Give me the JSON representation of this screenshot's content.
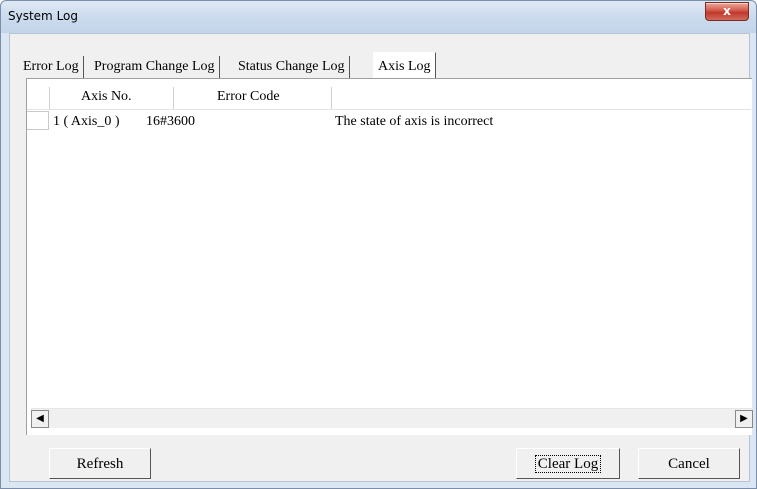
{
  "window": {
    "title": "System Log",
    "close_glyph": "x"
  },
  "tabs": [
    {
      "label": "Error Log"
    },
    {
      "label": "Program Change Log"
    },
    {
      "label": "Status Change Log"
    },
    {
      "label": "Axis Log",
      "active": true
    }
  ],
  "table": {
    "columns": [
      "Axis No.",
      "Error Code",
      ""
    ],
    "rows": [
      {
        "axis_no": "1 ( Axis_0 )",
        "error_code": "16#3600",
        "description": "The state of axis is incorrect"
      }
    ]
  },
  "scrollbar": {
    "left_arrow": "◀",
    "right_arrow": "▶"
  },
  "buttons": {
    "refresh": "Refresh",
    "clear_log": "Clear Log",
    "cancel": "Cancel"
  },
  "colors": {
    "title_bar": "#cddcee",
    "close_button": "#c0392b",
    "client_bg": "#f0f0f0"
  }
}
